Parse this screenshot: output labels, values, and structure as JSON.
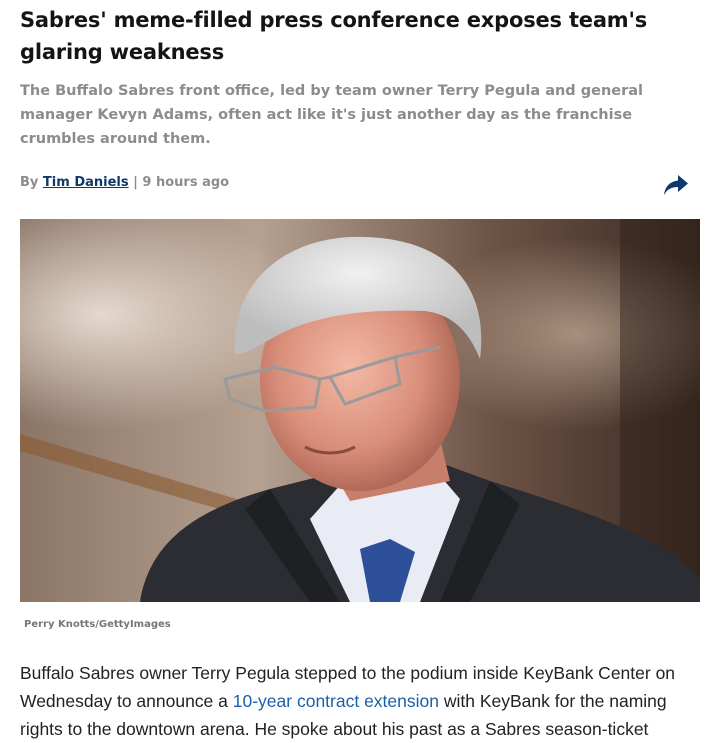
{
  "article": {
    "headline": "Sabres' meme-filled press conference exposes team's glaring weakness",
    "subhead": "The Buffalo Sabres front office, led by team owner Terry Pegula and general manager Kevyn Adams, often act like it's just another day as the franchise crumbles around them.",
    "byline_prefix": "By ",
    "author": "Tim Daniels",
    "separator": " | ",
    "timestamp": "9 hours ago",
    "share_icon": "share-arrow-icon",
    "image_credit": "Perry Knotts/GettyImages",
    "body_before_link": "Buffalo Sabres owner Terry Pegula stepped to the podium inside KeyBank Center on Wednesday to announce a ",
    "body_link": "10-year contract extension",
    "body_after_link": " with KeyBank for the naming rights to the downtown arena. He spoke about his past as a Sabres season-ticket"
  },
  "colors": {
    "author_link": "#10396b",
    "body_link": "#1d5fa8",
    "share_icon": "#10396b",
    "muted_text": "#8c8c8c"
  }
}
